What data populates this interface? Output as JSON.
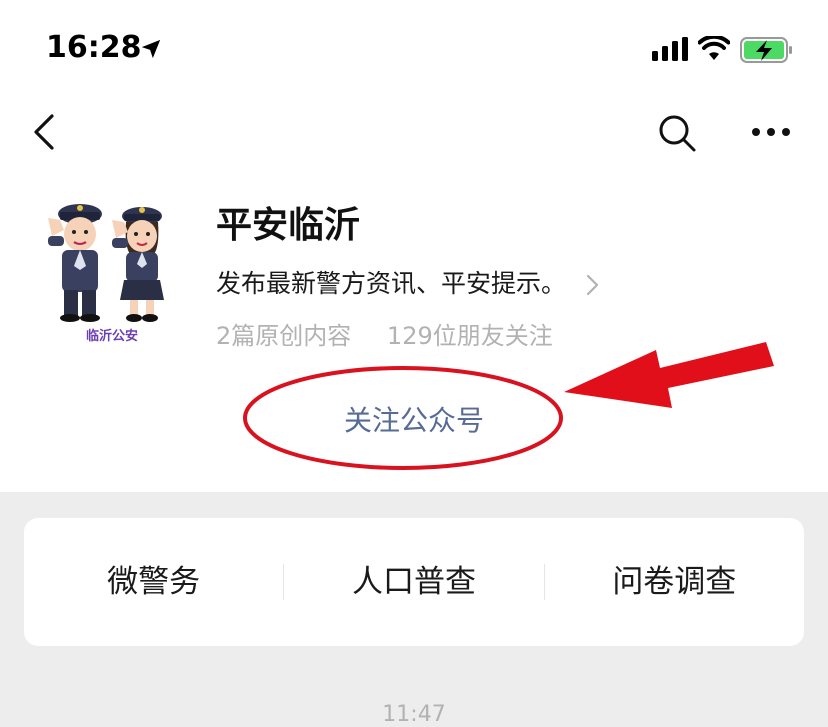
{
  "status_bar": {
    "time": "16:28",
    "icons": [
      "location-arrow-icon",
      "signal-icon",
      "wifi-icon",
      "battery-charging-icon"
    ],
    "battery_color": "#4cd964"
  },
  "nav": {
    "icons": [
      "back-icon",
      "search-icon",
      "more-icon"
    ]
  },
  "profile": {
    "name": "平安临沂",
    "description": "发布最新警方资讯、平安提示。",
    "original_count": "2篇原创内容",
    "followers": "129位朋友关注",
    "avatar_caption": "临沂公安",
    "follow_label": "关注公众号",
    "link_color": "#576b95"
  },
  "annotation": {
    "color": "#d9121f"
  },
  "menu": {
    "items": [
      {
        "label": "微警务"
      },
      {
        "label": "人口普查"
      },
      {
        "label": "问卷调查"
      }
    ]
  },
  "chat": {
    "timestamp": "11:47"
  }
}
